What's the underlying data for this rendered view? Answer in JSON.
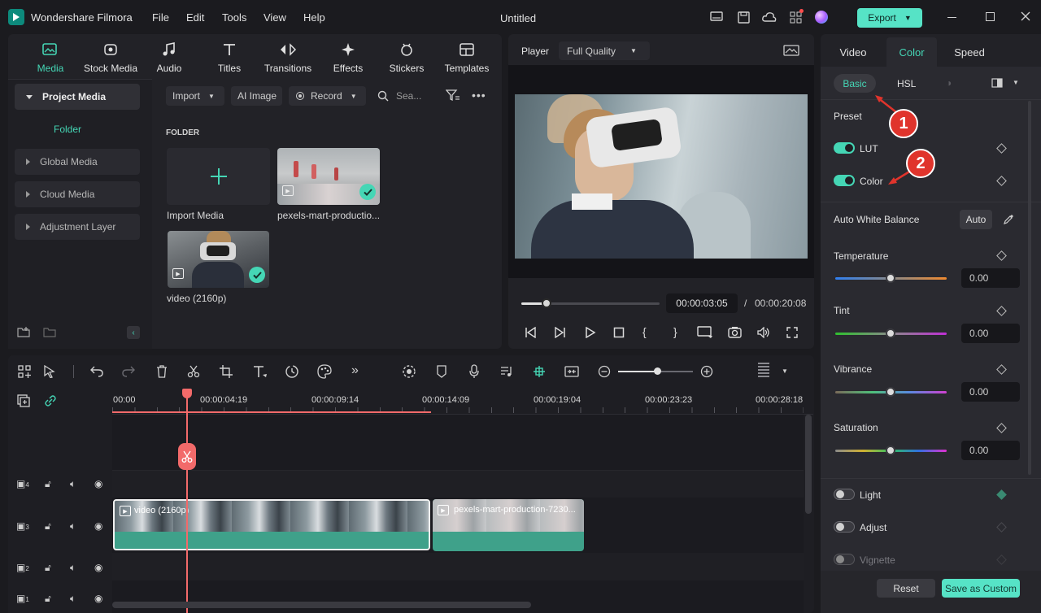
{
  "app": {
    "name": "Wondershare Filmora",
    "document_title": "Untitled"
  },
  "menu": [
    "File",
    "Edit",
    "Tools",
    "View",
    "Help"
  ],
  "export_label": "Export",
  "media_tabs": [
    "Media",
    "Stock Media",
    "Audio",
    "Titles",
    "Transitions",
    "Effects",
    "Stickers",
    "Templates"
  ],
  "sidebar": {
    "project_media": "Project Media",
    "folder": "Folder",
    "items": [
      "Global Media",
      "Cloud Media",
      "Adjustment Layer"
    ]
  },
  "media_toolbar": {
    "import": "Import",
    "ai_image": "AI Image",
    "record": "Record",
    "search_placeholder": "Sea..."
  },
  "library": {
    "folder_heading": "FOLDER",
    "import_media": "Import Media",
    "clips": [
      {
        "name": "pexels-mart-productio..."
      },
      {
        "name": "video (2160p)"
      }
    ]
  },
  "player": {
    "label": "Player",
    "quality": "Full Quality",
    "current_time": "00:00:03:05",
    "separator": "/",
    "total_time": "00:00:20:08",
    "progress": 0.18
  },
  "timeline": {
    "ruler": [
      "00:00",
      "00:00:04:19",
      "00:00:09:14",
      "00:00:14:09",
      "00:00:19:04",
      "00:00:23:23",
      "00:00:28:18"
    ],
    "tracks": [
      "4",
      "3",
      "2",
      "1"
    ],
    "clip_a": "video (2160p)",
    "clip_b": "pexels-mart-production-7230..."
  },
  "color_panel": {
    "tabs": [
      "Video",
      "Color",
      "Speed"
    ],
    "subtabs": [
      "Basic",
      "HSL"
    ],
    "preset": "Preset",
    "lut": "LUT",
    "color": "Color",
    "awb": "Auto White Balance",
    "auto": "Auto",
    "sliders": [
      {
        "label": "Temperature",
        "value": "0.00"
      },
      {
        "label": "Tint",
        "value": "0.00"
      },
      {
        "label": "Vibrance",
        "value": "0.00"
      },
      {
        "label": "Saturation",
        "value": "0.00"
      }
    ],
    "sections": [
      "Light",
      "Adjust",
      "Vignette"
    ],
    "reset": "Reset",
    "save_custom": "Save as Custom"
  },
  "callouts": [
    "1",
    "2"
  ],
  "colors": {
    "accent": "#45d6b5",
    "playhead": "#f26a6a",
    "callout": "#e0342c",
    "export": "#56e3c6"
  },
  "icons": [
    "filmora-logo-icon",
    "monitor-icon",
    "save-icon",
    "cloud-icon",
    "grid-icon",
    "avatar",
    "minimize-icon",
    "maximize-icon",
    "close-icon"
  ]
}
